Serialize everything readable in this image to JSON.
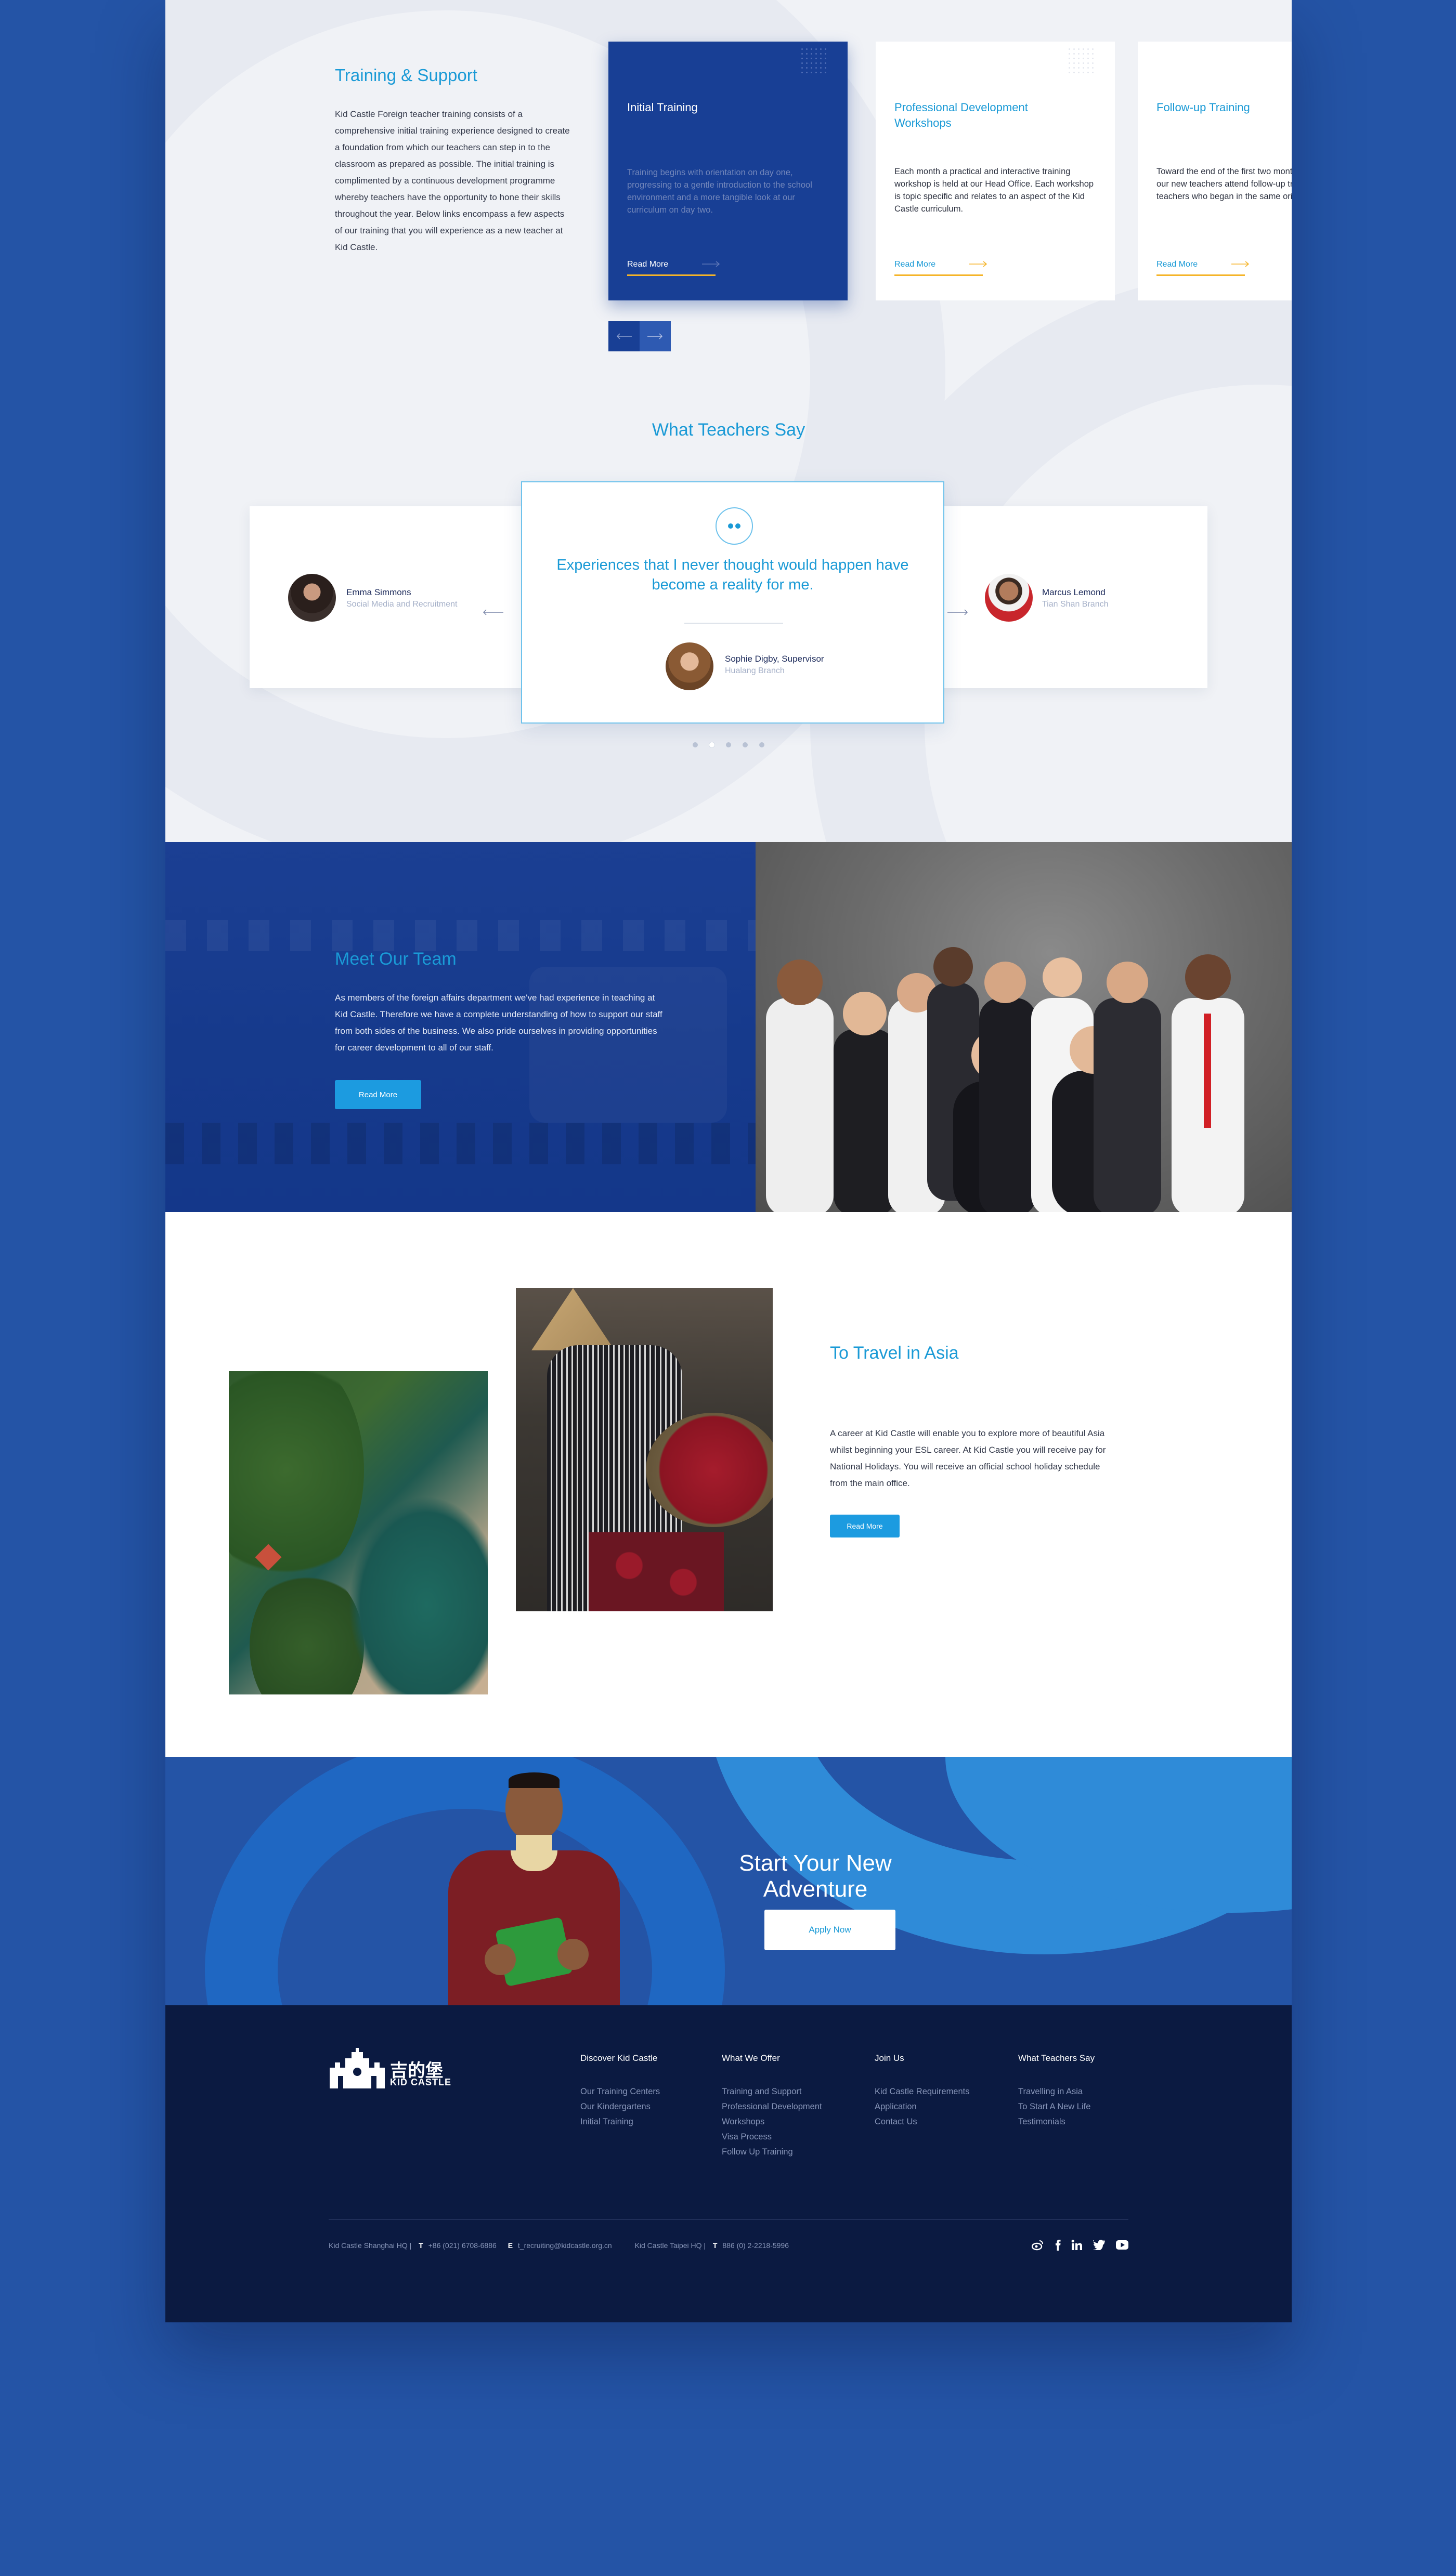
{
  "colors": {
    "accent": "#1a9ad6",
    "navy": "#183f95",
    "footer": "#0b1a41",
    "gold": "#f5b428",
    "page_bg": "#2454a6"
  },
  "training": {
    "title": "Training & Support",
    "intro": "Kid Castle Foreign teacher training consists of a comprehensive initial training experience designed to create a foundation from which our teachers can step in to the classroom as prepared as possible. The initial training is complimented by a continuous development programme whereby teachers have the opportunity to hone their skills throughout the year. Below links encompass a few aspects of our training that you will experience as a new teacher at Kid Castle.",
    "cards": [
      {
        "title": "Initial Training",
        "text": "Training begins with orientation on day one, progressing to a gentle introduction to the school environment and a more tangible look at our curriculum on day two.",
        "more": "Read More"
      },
      {
        "title": "Professional Development Workshops",
        "text": "Each month a practical and interactive training workshop is held at our Head Office. Each workshop is topic specific and relates to an aspect of the Kid Castle curriculum.",
        "more": "Read More"
      },
      {
        "title": "Follow-up Training",
        "text": "Toward the end of the first two months of teaching, our new teachers attend follow-up training with all teachers who began in the same orientation period.",
        "more": "Read More"
      }
    ],
    "prev_icon": "arrow-left-icon",
    "next_icon": "arrow-right-icon"
  },
  "testimonials": {
    "title": "What Teachers Say",
    "quote_icon": "quote-icon",
    "featured": {
      "quote": "Experiences that I never thought would happen have become a reality for me.",
      "name": "Sophie Digby, Supervisor",
      "role": "Hualang Branch"
    },
    "left": {
      "name": "Emma Simmons",
      "role": "Social Media and Recruitment"
    },
    "right": {
      "name": "Marcus Lemond",
      "role": "Tian Shan Branch"
    },
    "pager_count": 5,
    "pager_active": 2
  },
  "team": {
    "title": "Meet Our Team",
    "text": "As members of the foreign affairs department we've had  experience in teaching at Kid Castle. Therefore we have a complete understanding of how to support our staff from both sides of the business. We also pride ourselves in providing opportunities for career development to all of our staff.",
    "button": "Read More"
  },
  "travel": {
    "title": "To Travel in Asia",
    "text": "A career at Kid Castle will enable you to explore more of beautiful Asia whilst beginning your ESL career. At Kid Castle you will receive pay for National Holidays. You will receive an official school holiday schedule from the main office.",
    "button": "Read More"
  },
  "cta": {
    "title": "Start Your New Adventure",
    "button": "Apply Now"
  },
  "footer": {
    "logo_text": "KID CASTLE",
    "logo_cn": "吉的堡",
    "columns": [
      {
        "heading": "Discover Kid Castle",
        "links": [
          "Our Training Centers",
          "Our Kindergartens",
          "Initial Training"
        ]
      },
      {
        "heading": "What We Offer",
        "links": [
          "Training and Support",
          "Professional Development",
          "Workshops",
          "Visa Process",
          "Follow Up Training"
        ]
      },
      {
        "heading": "Join Us",
        "links": [
          "Kid Castle Requirements",
          "Application",
          "Contact Us"
        ]
      },
      {
        "heading": "What Teachers Say",
        "links": [
          "Travelling in Asia",
          "To Start A New Life",
          "Testimonials"
        ]
      }
    ],
    "hq1_name": "Kid Castle Shanghai HQ |",
    "hq1_t_label": "T",
    "hq1_phone": "+86 (021) 6708-6886",
    "hq1_e_label": "E",
    "hq1_email": "t_recruiting@kidcastle.org.cn",
    "hq2_name": "Kid Castle Taipei HQ |",
    "hq2_t_label": "T",
    "hq2_phone": "886 (0) 2-2218-5996",
    "social": [
      "weibo-icon",
      "facebook-icon",
      "linkedin-icon",
      "twitter-icon",
      "youtube-icon"
    ]
  }
}
